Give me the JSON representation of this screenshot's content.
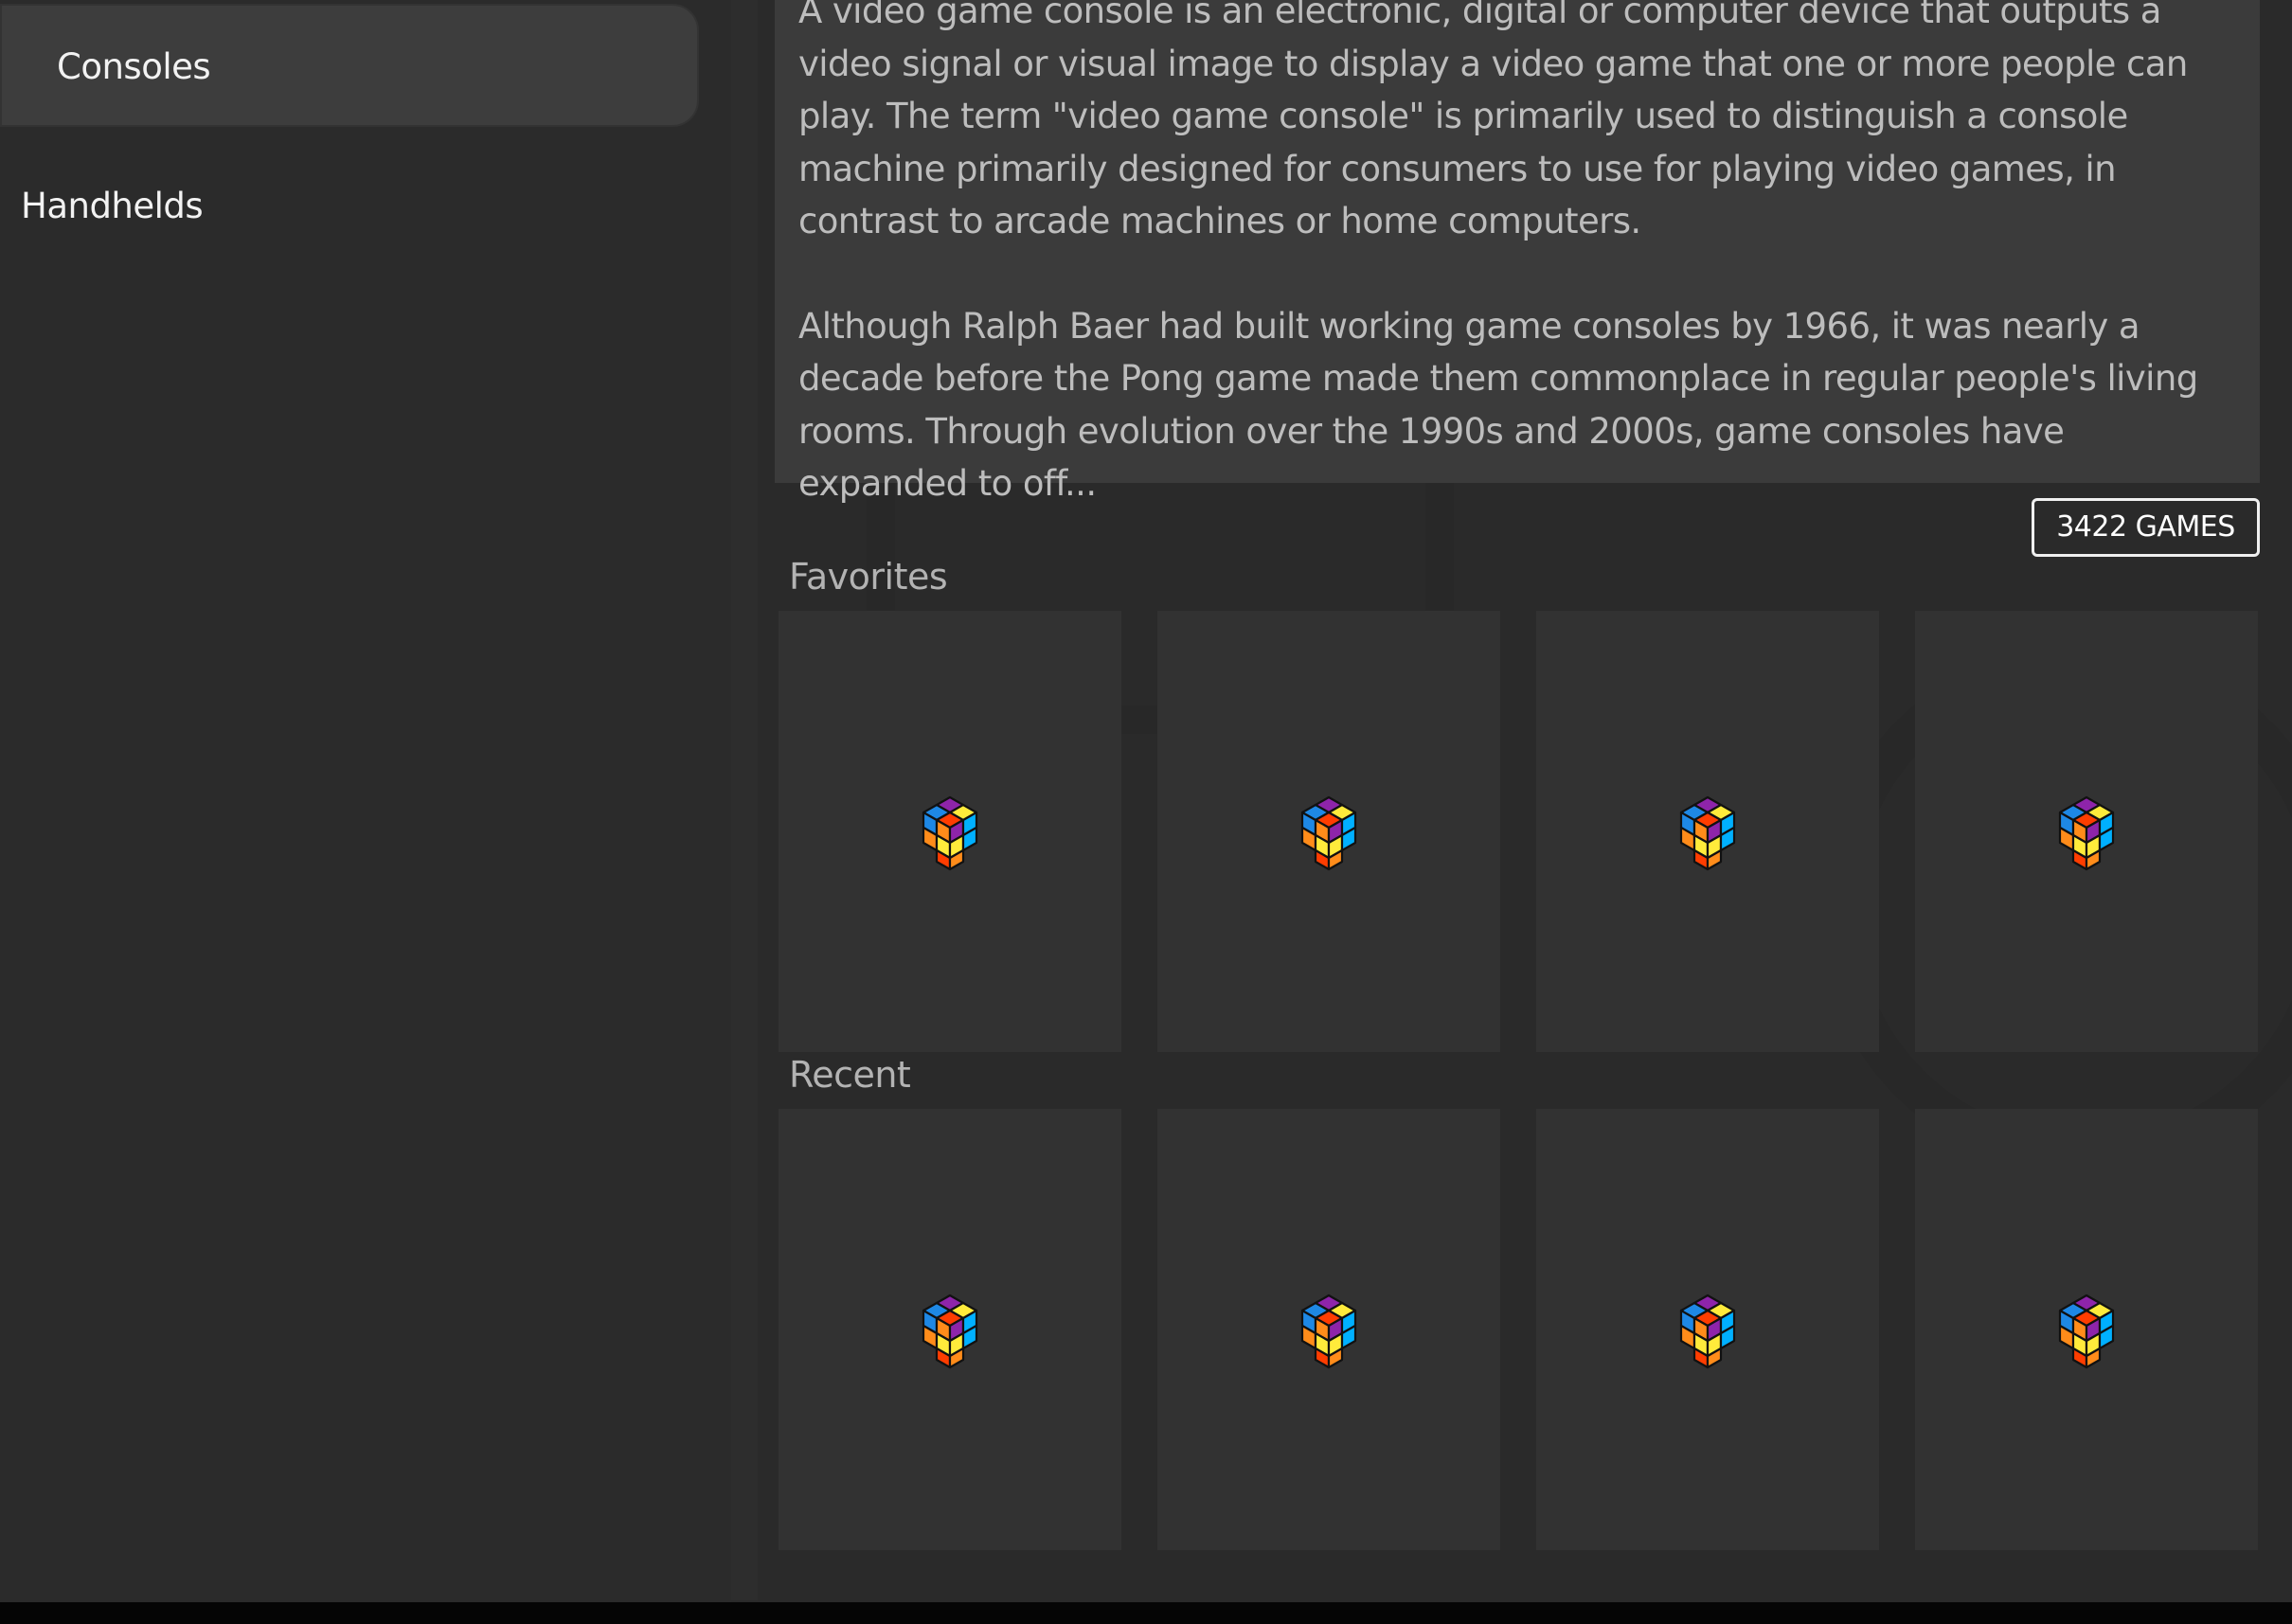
{
  "sidebar": {
    "items": [
      {
        "label": "Consoles",
        "active": true
      },
      {
        "label": "Handhelds",
        "active": false
      }
    ]
  },
  "description": {
    "paragraphs": [
      "A video game console is an electronic, digital or computer device that outputs a video signal or visual image to display a video game that one or more people can play. The term \"video game console\" is primarily used to distinguish a console machine primarily designed for consumers to use for playing video games, in contrast to arcade machines or home computers.",
      "Although Ralph Baer had built working game consoles by 1966, it was nearly a decade before the Pong game made them commonplace in regular people's living rooms. Through evolution over the 1990s and 2000s, game consoles have expanded to off..."
    ]
  },
  "games_count": "3422 GAMES",
  "sections": {
    "favorites": {
      "title": "Favorites",
      "tile_icon": "cube-icon",
      "tile_count": 4
    },
    "recent": {
      "title": "Recent",
      "tile_icon": "cube-icon",
      "tile_count": 4
    }
  },
  "colors": {
    "background": "#2a2a2a",
    "panel": "#3b3b3b",
    "tile": "#323232",
    "cube_faces": [
      "#ff8c1a",
      "#8e24aa",
      "#1e88e5",
      "#ffeb3b",
      "#ff3d00",
      "#00b0ff"
    ]
  }
}
